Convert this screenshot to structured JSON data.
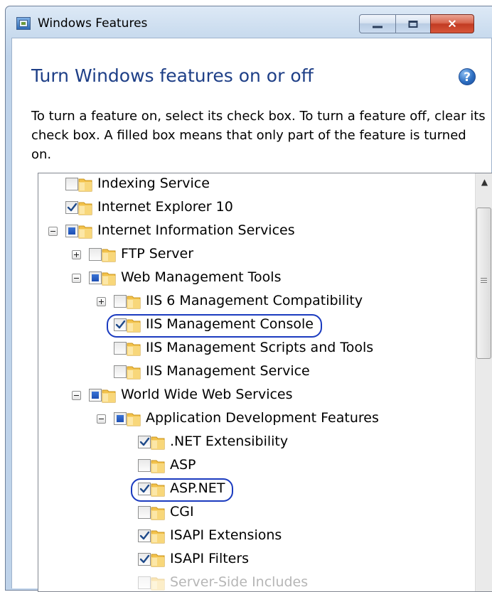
{
  "window": {
    "title": "Windows Features",
    "buttons": {
      "minimize": "minimize",
      "maximize": "maximize",
      "close": "×"
    },
    "accent": "#1e3f87"
  },
  "page": {
    "heading": "Turn Windows features on or off",
    "help": "?",
    "description": "To turn a feature on, select its check box. To turn a feature off, clear its check box. A filled box means that only part of the feature is turned on."
  },
  "features": [
    {
      "label": "Indexing Service",
      "level": 1,
      "state": "unchecked",
      "expander": "none"
    },
    {
      "label": "Internet Explorer 10",
      "level": 1,
      "state": "checked",
      "expander": "none"
    },
    {
      "label": "Internet Information Services",
      "level": 1,
      "state": "partial",
      "expander": "minus"
    },
    {
      "label": "FTP Server",
      "level": 2,
      "state": "unchecked",
      "expander": "plus"
    },
    {
      "label": "Web Management Tools",
      "level": 2,
      "state": "partial",
      "expander": "minus"
    },
    {
      "label": "IIS 6 Management Compatibility",
      "level": 3,
      "state": "unchecked",
      "expander": "plus"
    },
    {
      "label": "IIS Management Console",
      "level": 3,
      "state": "checked",
      "expander": "none",
      "highlighted": true
    },
    {
      "label": "IIS Management Scripts and Tools",
      "level": 3,
      "state": "unchecked",
      "expander": "none"
    },
    {
      "label": "IIS Management Service",
      "level": 3,
      "state": "unchecked",
      "expander": "none"
    },
    {
      "label": "World Wide Web Services",
      "level": 2,
      "state": "partial",
      "expander": "minus"
    },
    {
      "label": "Application Development Features",
      "level": 3,
      "state": "partial",
      "expander": "minus"
    },
    {
      "label": ".NET Extensibility",
      "level": 4,
      "state": "checked",
      "expander": "none"
    },
    {
      "label": "ASP",
      "level": 4,
      "state": "unchecked",
      "expander": "none"
    },
    {
      "label": "ASP.NET",
      "level": 4,
      "state": "checked",
      "expander": "none",
      "highlighted": true
    },
    {
      "label": "CGI",
      "level": 4,
      "state": "unchecked",
      "expander": "none"
    },
    {
      "label": "ISAPI Extensions",
      "level": 4,
      "state": "checked",
      "expander": "none"
    },
    {
      "label": "ISAPI Filters",
      "level": 4,
      "state": "checked",
      "expander": "none"
    },
    {
      "label": "Server-Side Includes",
      "level": 4,
      "state": "unchecked",
      "expander": "none",
      "faded": true
    }
  ],
  "highlight_color": "#1b3bbf"
}
